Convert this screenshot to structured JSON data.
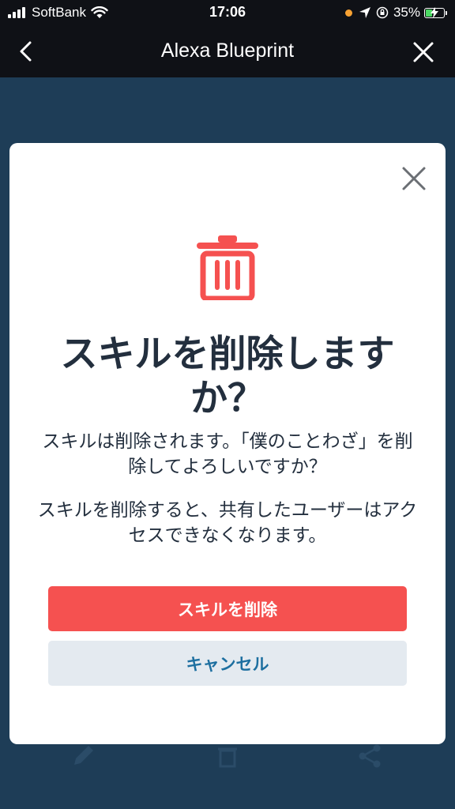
{
  "status_bar": {
    "carrier": "SoftBank",
    "time": "17:06",
    "battery": "35%"
  },
  "nav": {
    "title": "Alexa Blueprint"
  },
  "modal": {
    "title": "スキルを削除しますか？",
    "message1": "スキルは削除されます。「僕のことわざ」を削除してよろしいですか？",
    "message2": "スキルを削除すると、共有したユーザーはアクセスできなくなります。",
    "delete_label": "スキルを削除",
    "cancel_label": "キャンセル"
  },
  "colors": {
    "danger": "#f55150",
    "cancel_bg": "#e4eaf0",
    "cancel_text": "#1d6fa0",
    "backdrop": "#1e3d57"
  },
  "icons": [
    "wifi-icon",
    "location-arrow-icon",
    "rotation-lock-icon",
    "battery-charging-icon",
    "back-arrow-icon",
    "close-icon",
    "trash-icon",
    "edit-icon",
    "share-icon"
  ]
}
